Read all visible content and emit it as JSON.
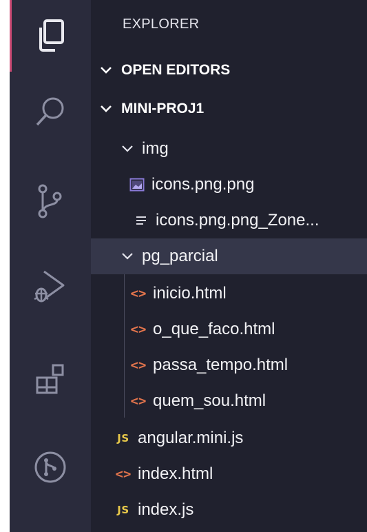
{
  "sidebar": {
    "title": "EXPLORER",
    "open_editors": "OPEN EDITORS",
    "project": "MINI-PROJ1",
    "tree": [
      {
        "label": "img",
        "kind": "folder-open",
        "icon": "chevron-down-icon"
      },
      {
        "label": "icons.png.png",
        "kind": "file",
        "icon": "image-file-icon"
      },
      {
        "label": "icons.png.png_Zone...",
        "kind": "file",
        "icon": "text-file-icon"
      },
      {
        "label": "pg_parcial",
        "kind": "folder-open",
        "icon": "chevron-down-icon",
        "selected": true
      },
      {
        "label": "inicio.html",
        "kind": "file",
        "icon": "html-file-icon"
      },
      {
        "label": "o_que_faco.html",
        "kind": "file",
        "icon": "html-file-icon"
      },
      {
        "label": "passa_tempo.html",
        "kind": "file",
        "icon": "html-file-icon"
      },
      {
        "label": "quem_sou.html",
        "kind": "file",
        "icon": "html-file-icon"
      },
      {
        "label": "angular.mini.js",
        "kind": "file",
        "icon": "js-file-icon"
      },
      {
        "label": "index.html",
        "kind": "file",
        "icon": "html-file-icon"
      },
      {
        "label": "index.js",
        "kind": "file",
        "icon": "js-file-icon"
      }
    ],
    "icon_glyphs": {
      "js": "JS",
      "html": "<>"
    }
  },
  "activity_bar": {
    "items": [
      "explorer-icon",
      "search-icon",
      "source-control-icon",
      "run-debug-icon",
      "extensions-icon",
      "git-graph-icon"
    ]
  },
  "colors": {
    "sidebar_bg": "#20212e",
    "activity_bg": "#2a2b3c",
    "selected_row": "#35374a",
    "accent": "#cc4b75",
    "js_yellow": "#e8c94a",
    "html_orange": "#e2744c",
    "image_purple": "#8a7ad8"
  }
}
